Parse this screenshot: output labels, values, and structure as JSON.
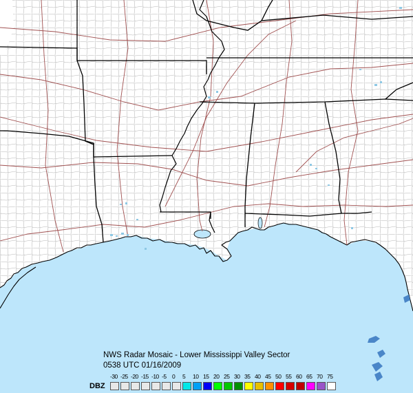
{
  "caption": {
    "title": "NWS Radar Mosaic - Lower Mississippi Valley Sector",
    "timestamp": "0538 UTC 01/16/2009"
  },
  "legend": {
    "unit": "DBZ",
    "levels": [
      {
        "label": "-30",
        "color": "#e8e8e8"
      },
      {
        "label": "-25",
        "color": "#e8e8e8"
      },
      {
        "label": "-20",
        "color": "#e8e8e8"
      },
      {
        "label": "-15",
        "color": "#e8e8e8"
      },
      {
        "label": "-10",
        "color": "#e8e8e8"
      },
      {
        "label": "-5",
        "color": "#e8e8e8"
      },
      {
        "label": "0",
        "color": "#e8e8e8"
      },
      {
        "label": "5",
        "color": "#00e8e8"
      },
      {
        "label": "10",
        "color": "#00a0f6"
      },
      {
        "label": "15",
        "color": "#0000f6"
      },
      {
        "label": "20",
        "color": "#00ff00"
      },
      {
        "label": "25",
        "color": "#00c800"
      },
      {
        "label": "30",
        "color": "#009000"
      },
      {
        "label": "35",
        "color": "#ffff00"
      },
      {
        "label": "40",
        "color": "#e7c000"
      },
      {
        "label": "45",
        "color": "#ff9000"
      },
      {
        "label": "50",
        "color": "#ff0000"
      },
      {
        "label": "55",
        "color": "#d60000"
      },
      {
        "label": "60",
        "color": "#c00000"
      },
      {
        "label": "65",
        "color": "#ff00ff"
      },
      {
        "label": "70",
        "color": "#9955c9"
      },
      {
        "label": "75",
        "color": "#ffffff"
      }
    ]
  },
  "map": {
    "land_color": "#ffffff",
    "water_color": "#bde6fb",
    "county_line_color": "#b4b4b4",
    "highway_color": "#a05050",
    "state_line_color": "#000000"
  }
}
